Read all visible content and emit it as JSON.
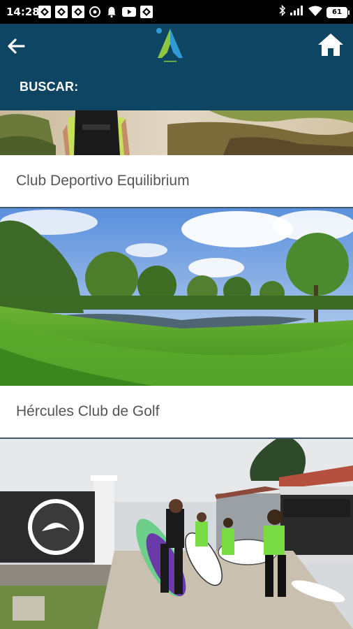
{
  "status_bar": {
    "time": "14:28",
    "battery": "61",
    "notification_icons": [
      "app-notification-icon",
      "app-notification-icon",
      "app-notification-icon",
      "chrome-icon",
      "bell-icon",
      "youtube-icon",
      "app-notification-icon"
    ],
    "system_icons": [
      "bluetooth-icon",
      "signal-icon",
      "wifi-icon",
      "battery-icon"
    ]
  },
  "header": {
    "back_icon": "arrow-left-icon",
    "logo_icon": "app-logo-icon",
    "home_icon": "home-icon",
    "search_label": "BUSCAR:",
    "colors": {
      "background": "#0e4563",
      "logo_green": "#8dc63f",
      "logo_blue": "#2f9ad4"
    }
  },
  "listings": [
    {
      "name": "Club Deportivo Equilibrium",
      "image": "person with backpack on sand dunes"
    },
    {
      "name": "Hércules Club de Golf",
      "image": "golf course with pond and trees"
    },
    {
      "name": "",
      "image": "surf club entrance with surfers carrying boards"
    }
  ]
}
